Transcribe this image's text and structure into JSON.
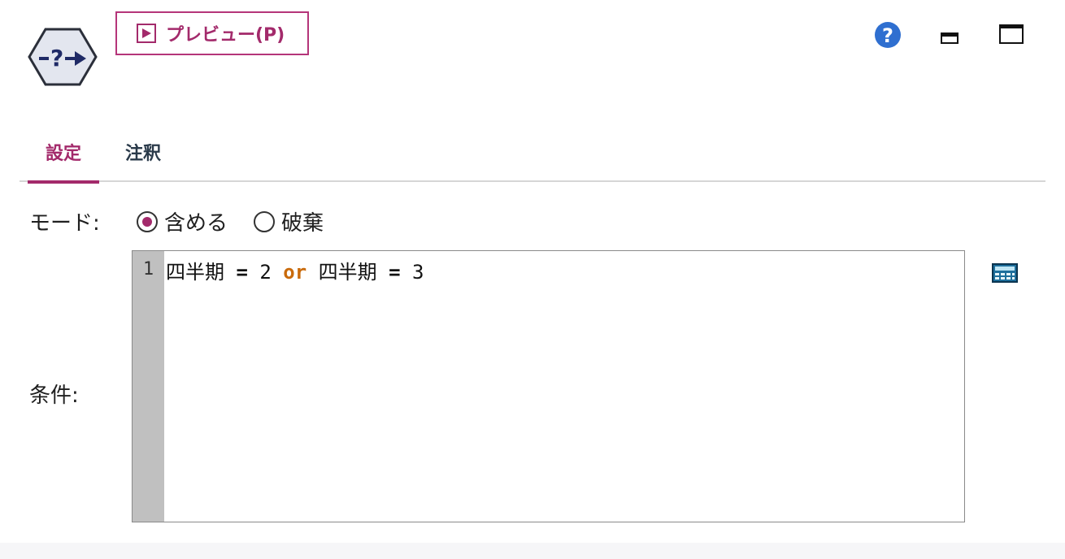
{
  "header": {
    "node_icon": "select-node-icon",
    "preview_label": "プレビュー(P)",
    "preview_icon": "play-icon",
    "help_icon": "help-icon",
    "minimize_icon": "minimize-icon",
    "maximize_icon": "maximize-icon"
  },
  "tabs": [
    {
      "label": "設定",
      "active": true
    },
    {
      "label": "注釈",
      "active": false
    }
  ],
  "mode": {
    "label": "モード:",
    "options": [
      {
        "label": "含める",
        "selected": true
      },
      {
        "label": "破棄",
        "selected": false
      }
    ]
  },
  "condition": {
    "label": "条件:",
    "line_number": "1",
    "tokens": {
      "field1": "四半期",
      "eq1": "=",
      "val1": "2",
      "keyword": "or",
      "field2": "四半期",
      "eq2": "=",
      "val2": "3"
    },
    "expression_builder_icon": "calculator-icon"
  },
  "colors": {
    "accent": "#a32a6b",
    "keyword": "#c96a0b",
    "help_blue": "#2f6fd0"
  }
}
